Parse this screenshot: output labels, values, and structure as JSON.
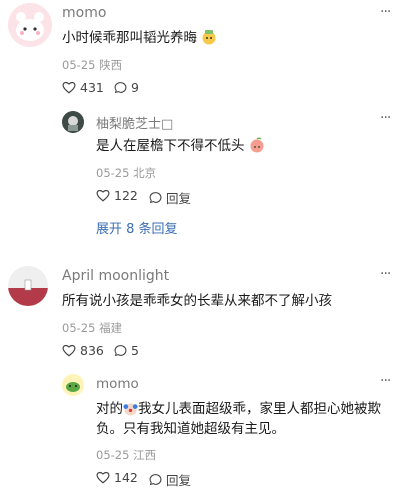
{
  "comments": [
    {
      "username": "momo",
      "text": "小时候乖那叫韬光养晦",
      "date": "05-25",
      "location": "陕西",
      "likes": "431",
      "replies_count": "9",
      "replies": [
        {
          "username": "柚梨脆芝士□",
          "text": "是人在屋檐下不得不低头",
          "date": "05-25",
          "location": "北京",
          "likes": "122",
          "reply_label": "回复"
        }
      ],
      "expand_label": "展开 8 条回复"
    },
    {
      "username": "April moonlight",
      "text": "所有说小孩是乖乖女的长辈从来都不了解小孩",
      "date": "05-25",
      "location": "福建",
      "likes": "836",
      "replies_count": "5",
      "replies": [
        {
          "username": "momo",
          "text_a": "对的",
          "text_b": "我女儿表面超级乖，家里人都担心她被欺",
          "text_c": "负。只有我知道她超级有主见。",
          "date": "05-25",
          "location": "江西",
          "likes": "142",
          "reply_label": "回复"
        }
      ]
    }
  ],
  "icons": {
    "more": "more-dots-icon",
    "like": "heart-icon",
    "reply": "comment-bubble-icon"
  },
  "colors": {
    "link": "#3b6db3",
    "meta": "#9a9a9a"
  }
}
